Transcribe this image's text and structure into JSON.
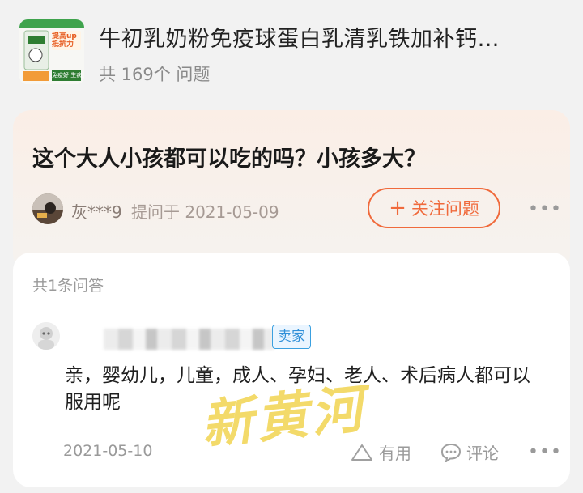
{
  "product": {
    "title": "牛初乳奶粉免疫球蛋白乳清乳铁加补钙…",
    "question_count": "共 169个 问题",
    "thumb": {
      "badge": "提高up 抵抗力",
      "tagline": "免疫好 生病少"
    }
  },
  "question": {
    "text": "这个大人小孩都可以吃的吗？小孩多大？",
    "asker": "灰***9",
    "asked_at": "提问于 2021-05-09",
    "follow_label": "关注问题",
    "follow_icon": "+"
  },
  "answers": {
    "count_label": "共1条问答",
    "item": {
      "badge": "卖家",
      "text": "亲，婴幼儿，儿童，成人、孕妇、老人、术后病人都可以服用呢",
      "date": "2021-05-10",
      "useful_label": "有用",
      "comment_label": "评论"
    }
  },
  "watermark": "新黄河",
  "more_glyph": "•••",
  "colors": {
    "accent": "#f06a3c",
    "seller_badge": "#2f8fd8",
    "watermark": "#f1d34a"
  }
}
